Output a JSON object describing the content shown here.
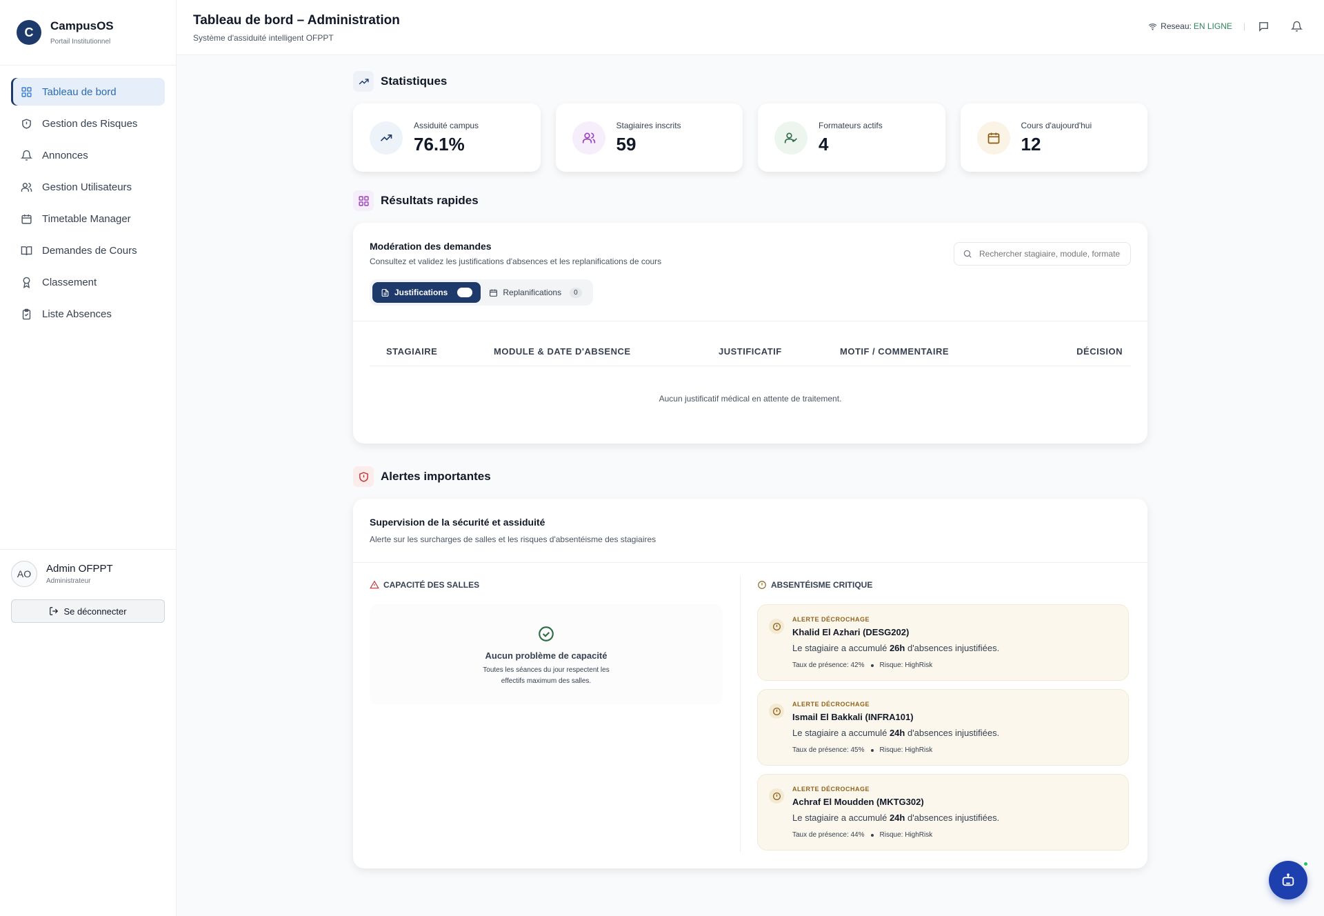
{
  "brand": {
    "initial": "C",
    "name": "CampusOS",
    "subtitle": "Portail Institutionnel"
  },
  "sidebar": {
    "items": [
      {
        "label": "Tableau de bord",
        "icon": "grid-icon",
        "active": true
      },
      {
        "label": "Gestion des Risques",
        "icon": "shield-icon"
      },
      {
        "label": "Annonces",
        "icon": "bell-icon"
      },
      {
        "label": "Gestion Utilisateurs",
        "icon": "users-icon"
      },
      {
        "label": "Timetable Manager",
        "icon": "calendar-icon"
      },
      {
        "label": "Demandes de Cours",
        "icon": "book-icon"
      },
      {
        "label": "Classement",
        "icon": "award-icon"
      },
      {
        "label": "Liste Absences",
        "icon": "clipboard-icon"
      }
    ]
  },
  "user": {
    "initials": "AO",
    "name": "Admin OFPPT",
    "role": "Administrateur",
    "logout_label": "Se déconnecter"
  },
  "header": {
    "title": "Tableau de bord – Administration",
    "subtitle": "Système d'assiduité intelligent OFPPT",
    "network_label": "Reseau:",
    "network_status": "EN LIGNE",
    "separator": "|"
  },
  "sections": {
    "stats_title": "Statistiques",
    "results_title": "Résultats rapides",
    "alerts_title": "Alertes importantes"
  },
  "stats": [
    {
      "label": "Assiduité campus",
      "value": "76.1%",
      "icon": "trending-up-icon",
      "color": "#1e3a6b",
      "bg": "#eef3fa"
    },
    {
      "label": "Stagiaires inscrits",
      "value": "59",
      "icon": "users-icon",
      "color": "#9b3fbf",
      "bg": "#f7eefb"
    },
    {
      "label": "Formateurs actifs",
      "value": "4",
      "icon": "user-check-icon",
      "color": "#2f6b47",
      "bg": "#edf5ef"
    },
    {
      "label": "Cours d'aujourd'hui",
      "value": "12",
      "icon": "calendar-icon",
      "color": "#8a5a12",
      "bg": "#fbf4e6"
    }
  ],
  "moderation": {
    "title": "Modération des demandes",
    "description": "Consultez et validez les justifications d'absences et les replanifications de cours",
    "search_placeholder": "Rechercher stagiaire, module, formateur...",
    "tabs": [
      {
        "label": "Justifications",
        "active": true
      },
      {
        "label": "Replanifications",
        "count": "0"
      }
    ],
    "columns": [
      "STAGIAIRE",
      "MODULE & DATE D'ABSENCE",
      "JUSTIFICATIF",
      "MOTIF / COMMENTAIRE",
      "DÉCISION"
    ],
    "empty_message": "Aucun justificatif médical en attente de traitement."
  },
  "supervision": {
    "title": "Supervision de la sécurité et assiduité",
    "description": "Alerte sur les surcharges de salles et les risques d'absentéisme des stagiaires",
    "capacity_title": "CAPACITÉ DES SALLES",
    "capacity_ok_title": "Aucun problème de capacité",
    "capacity_ok_desc": "Toutes les séances du jour respectent les effectifs maximum des salles.",
    "absenteeism_title": "ABSENTÉISME CRITIQUE",
    "alerts": [
      {
        "tag": "ALERTE DÉCROCHAGE",
        "name": "Khalid El Azhari (DESG202)",
        "text_before": "Le stagiaire a accumulé",
        "hours": "26h",
        "text_after": "d'absences injustifiées.",
        "presence": "Taux de présence: 42%",
        "risk": "Risque: HighRisk"
      },
      {
        "tag": "ALERTE DÉCROCHAGE",
        "name": "Ismail El Bakkali (INFRA101)",
        "text_before": "Le stagiaire a accumulé",
        "hours": "24h",
        "text_after": "d'absences injustifiées.",
        "presence": "Taux de présence: 45%",
        "risk": "Risque: HighRisk"
      },
      {
        "tag": "ALERTE DÉCROCHAGE",
        "name": "Achraf El Moudden (MKTG302)",
        "text_before": "Le stagiaire a accumulé",
        "hours": "24h",
        "text_after": "d'absences injustifiées.",
        "presence": "Taux de présence: 44%",
        "risk": "Risque: HighRisk"
      }
    ]
  },
  "colors": {
    "primary": "#1e3a6b",
    "active_nav": "#2b6cb0",
    "online": "#2f855a",
    "alert_bg": "#fbf7ec",
    "alert_accent": "#92621b",
    "bot": "#1e40af"
  }
}
